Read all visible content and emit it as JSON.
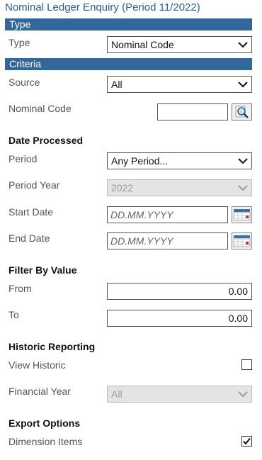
{
  "title": "Nominal Ledger Enquiry (Period 11/2022)",
  "sections": {
    "type_band": "Type",
    "criteria_band": "Criteria"
  },
  "type": {
    "label": "Type",
    "value": "Nominal Code"
  },
  "source": {
    "label": "Source",
    "value": "All"
  },
  "nominal_code": {
    "label": "Nominal Code",
    "value": ""
  },
  "date_processed": {
    "heading": "Date Processed",
    "period_label": "Period",
    "period_value": "Any Period...",
    "period_year_label": "Period Year",
    "period_year_value": "2022",
    "start_date_label": "Start Date",
    "start_date_placeholder": "DD.MM.YYYY",
    "end_date_label": "End Date",
    "end_date_placeholder": "DD.MM.YYYY"
  },
  "filter_by_value": {
    "heading": "Filter By Value",
    "from_label": "From",
    "from_value": "0.00",
    "to_label": "To",
    "to_value": "0.00"
  },
  "historic_reporting": {
    "heading": "Historic Reporting",
    "view_historic_label": "View Historic",
    "view_historic_checked": false,
    "financial_year_label": "Financial Year",
    "financial_year_value": "All"
  },
  "export_options": {
    "heading": "Export Options",
    "dimension_items_label": "Dimension Items",
    "dimension_items_checked": true
  },
  "colors": {
    "band": "#336699",
    "title": "#2a6099"
  }
}
